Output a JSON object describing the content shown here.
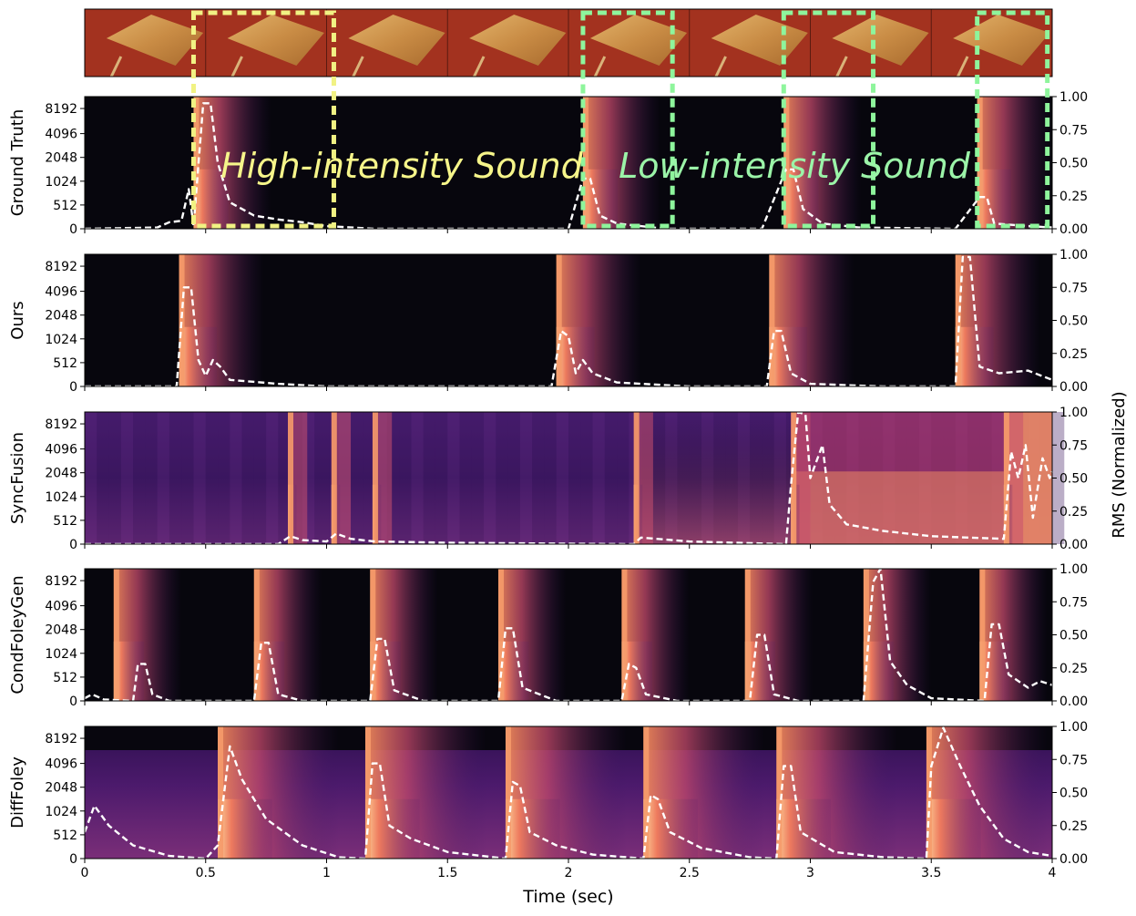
{
  "colors": {
    "high_box": "#f1f283",
    "low_box": "#8ef59c",
    "high_text": "#f6f58a",
    "low_text": "#9bf4a8",
    "rms_line": "#ffffff"
  },
  "filmstrip": {
    "frames": 8,
    "high_boxes": [
      [
        0.45,
        1.03
      ]
    ],
    "low_boxes": [
      [
        2.06,
        2.43
      ],
      [
        2.89,
        3.26
      ],
      [
        3.69,
        3.98
      ]
    ]
  },
  "annotations": {
    "high": "High-intensity Sound",
    "low": "Low-intensity Sound"
  },
  "axes": {
    "xlabel": "Time (sec)",
    "right_label": "RMS (Normalized)",
    "x_ticks": [
      "0",
      "0.5",
      "1",
      "1.5",
      "2",
      "2.5",
      "3",
      "3.5",
      "4"
    ],
    "y_ticks": [
      "0",
      "512",
      "1024",
      "2048",
      "4096",
      "8192"
    ],
    "rms_ticks": [
      "0.00",
      "0.25",
      "0.50",
      "0.75",
      "1.00"
    ]
  },
  "chart_data": [
    {
      "type": "line",
      "title": "",
      "ylabel": "Ground Truth",
      "xlim": [
        0,
        4
      ],
      "ylim": [
        0,
        1
      ],
      "onsets": [
        0.45,
        2.06,
        2.89,
        3.69
      ],
      "rms": [
        [
          0,
          0
        ],
        [
          0.3,
          0.01
        ],
        [
          0.35,
          0.05
        ],
        [
          0.4,
          0.06
        ],
        [
          0.43,
          0.3
        ],
        [
          0.45,
          0.02
        ],
        [
          0.49,
          0.95
        ],
        [
          0.52,
          0.95
        ],
        [
          0.55,
          0.5
        ],
        [
          0.6,
          0.2
        ],
        [
          0.7,
          0.1
        ],
        [
          0.8,
          0.07
        ],
        [
          0.9,
          0.05
        ],
        [
          1.0,
          0.02
        ],
        [
          1.2,
          0.0
        ],
        [
          2.0,
          0.0
        ],
        [
          2.06,
          0.38
        ],
        [
          2.09,
          0.38
        ],
        [
          2.13,
          0.1
        ],
        [
          2.2,
          0.04
        ],
        [
          2.4,
          0.0
        ],
        [
          2.8,
          0.0
        ],
        [
          2.9,
          0.45
        ],
        [
          2.93,
          0.45
        ],
        [
          2.97,
          0.15
        ],
        [
          3.05,
          0.04
        ],
        [
          3.2,
          0.01
        ],
        [
          3.6,
          0.0
        ],
        [
          3.7,
          0.24
        ],
        [
          3.73,
          0.24
        ],
        [
          3.76,
          0.04
        ],
        [
          3.9,
          0.02
        ],
        [
          4.0,
          0.01
        ]
      ]
    },
    {
      "type": "line",
      "title": "",
      "ylabel": "Ours",
      "xlim": [
        0,
        4
      ],
      "ylim": [
        0,
        1
      ],
      "onsets": [
        0.39,
        1.95,
        2.83,
        3.6
      ],
      "rms": [
        [
          0,
          0
        ],
        [
          0.38,
          0.0
        ],
        [
          0.41,
          0.75
        ],
        [
          0.44,
          0.75
        ],
        [
          0.47,
          0.2
        ],
        [
          0.5,
          0.08
        ],
        [
          0.53,
          0.2
        ],
        [
          0.56,
          0.15
        ],
        [
          0.6,
          0.05
        ],
        [
          0.8,
          0.02
        ],
        [
          1.0,
          0.0
        ],
        [
          1.93,
          0.0
        ],
        [
          1.97,
          0.42
        ],
        [
          2.0,
          0.38
        ],
        [
          2.03,
          0.1
        ],
        [
          2.06,
          0.2
        ],
        [
          2.1,
          0.1
        ],
        [
          2.2,
          0.03
        ],
        [
          2.5,
          0.0
        ],
        [
          2.82,
          0.0
        ],
        [
          2.85,
          0.42
        ],
        [
          2.88,
          0.42
        ],
        [
          2.92,
          0.1
        ],
        [
          3.0,
          0.02
        ],
        [
          3.3,
          0.0
        ],
        [
          3.6,
          0.0
        ],
        [
          3.63,
          0.98
        ],
        [
          3.66,
          0.98
        ],
        [
          3.7,
          0.15
        ],
        [
          3.78,
          0.1
        ],
        [
          3.9,
          0.12
        ],
        [
          4.0,
          0.05
        ]
      ]
    },
    {
      "type": "line",
      "title": "",
      "ylabel": "SyncFusion",
      "xlim": [
        0,
        4
      ],
      "ylim": [
        0,
        1
      ],
      "onsets": [
        0.84,
        1.02,
        1.19,
        2.27,
        2.92,
        3.8
      ],
      "rms": [
        [
          0,
          0
        ],
        [
          0.8,
          0.0
        ],
        [
          0.85,
          0.06
        ],
        [
          0.9,
          0.03
        ],
        [
          1.0,
          0.02
        ],
        [
          1.04,
          0.08
        ],
        [
          1.1,
          0.04
        ],
        [
          1.2,
          0.02
        ],
        [
          1.5,
          0.01
        ],
        [
          2.27,
          0.0
        ],
        [
          2.3,
          0.05
        ],
        [
          2.5,
          0.02
        ],
        [
          2.9,
          0.0
        ],
        [
          2.92,
          0.45
        ],
        [
          2.95,
          1.0
        ],
        [
          2.98,
          0.98
        ],
        [
          3.0,
          0.5
        ],
        [
          3.05,
          0.75
        ],
        [
          3.08,
          0.3
        ],
        [
          3.15,
          0.15
        ],
        [
          3.3,
          0.1
        ],
        [
          3.5,
          0.06
        ],
        [
          3.8,
          0.04
        ],
        [
          3.83,
          0.7
        ],
        [
          3.86,
          0.5
        ],
        [
          3.89,
          0.75
        ],
        [
          3.92,
          0.2
        ],
        [
          3.96,
          0.65
        ],
        [
          3.99,
          0.5
        ],
        [
          4.0,
          0.55
        ]
      ]
    },
    {
      "type": "line",
      "title": "",
      "ylabel": "CondFoleyGen",
      "xlim": [
        0,
        4
      ],
      "ylim": [
        0,
        1
      ],
      "onsets": [
        0.12,
        0.7,
        1.18,
        1.71,
        2.22,
        2.73,
        3.22,
        3.7
      ],
      "rms": [
        [
          0,
          0.02
        ],
        [
          0.03,
          0.05
        ],
        [
          0.08,
          0.01
        ],
        [
          0.2,
          0.0
        ],
        [
          0.22,
          0.28
        ],
        [
          0.25,
          0.28
        ],
        [
          0.28,
          0.05
        ],
        [
          0.35,
          0.0
        ],
        [
          0.7,
          0.0
        ],
        [
          0.73,
          0.44
        ],
        [
          0.76,
          0.44
        ],
        [
          0.8,
          0.05
        ],
        [
          0.9,
          0.0
        ],
        [
          1.18,
          0.0
        ],
        [
          1.21,
          0.47
        ],
        [
          1.24,
          0.47
        ],
        [
          1.28,
          0.08
        ],
        [
          1.4,
          0.0
        ],
        [
          1.71,
          0.0
        ],
        [
          1.74,
          0.55
        ],
        [
          1.77,
          0.55
        ],
        [
          1.81,
          0.1
        ],
        [
          1.95,
          0.0
        ],
        [
          2.22,
          0.0
        ],
        [
          2.25,
          0.28
        ],
        [
          2.28,
          0.25
        ],
        [
          2.32,
          0.05
        ],
        [
          2.45,
          0.0
        ],
        [
          2.75,
          0.0
        ],
        [
          2.78,
          0.5
        ],
        [
          2.81,
          0.5
        ],
        [
          2.85,
          0.05
        ],
        [
          2.95,
          0.0
        ],
        [
          3.22,
          0.0
        ],
        [
          3.26,
          0.9
        ],
        [
          3.29,
          1.0
        ],
        [
          3.33,
          0.3
        ],
        [
          3.4,
          0.12
        ],
        [
          3.5,
          0.02
        ],
        [
          3.72,
          0.0
        ],
        [
          3.75,
          0.58
        ],
        [
          3.78,
          0.58
        ],
        [
          3.82,
          0.2
        ],
        [
          3.9,
          0.1
        ],
        [
          3.95,
          0.15
        ],
        [
          4.0,
          0.12
        ]
      ]
    },
    {
      "type": "line",
      "title": "",
      "ylabel": "DiffFoley",
      "xlim": [
        0,
        4
      ],
      "ylim": [
        0,
        1
      ],
      "onsets": [
        0.55,
        1.16,
        1.74,
        2.31,
        2.86,
        3.48
      ],
      "rms": [
        [
          0,
          0.2
        ],
        [
          0.04,
          0.4
        ],
        [
          0.1,
          0.25
        ],
        [
          0.2,
          0.1
        ],
        [
          0.35,
          0.02
        ],
        [
          0.5,
          0.0
        ],
        [
          0.55,
          0.1
        ],
        [
          0.6,
          0.85
        ],
        [
          0.65,
          0.6
        ],
        [
          0.75,
          0.3
        ],
        [
          0.9,
          0.1
        ],
        [
          1.05,
          0.01
        ],
        [
          1.16,
          0.0
        ],
        [
          1.19,
          0.72
        ],
        [
          1.22,
          0.72
        ],
        [
          1.26,
          0.25
        ],
        [
          1.35,
          0.15
        ],
        [
          1.5,
          0.05
        ],
        [
          1.74,
          0.0
        ],
        [
          1.77,
          0.58
        ],
        [
          1.8,
          0.55
        ],
        [
          1.84,
          0.2
        ],
        [
          1.95,
          0.1
        ],
        [
          2.1,
          0.03
        ],
        [
          2.31,
          0.0
        ],
        [
          2.34,
          0.48
        ],
        [
          2.37,
          0.45
        ],
        [
          2.42,
          0.2
        ],
        [
          2.55,
          0.08
        ],
        [
          2.75,
          0.01
        ],
        [
          2.86,
          0.0
        ],
        [
          2.89,
          0.7
        ],
        [
          2.92,
          0.7
        ],
        [
          2.96,
          0.2
        ],
        [
          3.1,
          0.05
        ],
        [
          3.3,
          0.01
        ],
        [
          3.48,
          0.0
        ],
        [
          3.5,
          0.7
        ],
        [
          3.55,
          0.99
        ],
        [
          3.62,
          0.7
        ],
        [
          3.7,
          0.4
        ],
        [
          3.8,
          0.15
        ],
        [
          3.9,
          0.05
        ],
        [
          4.0,
          0.02
        ]
      ]
    }
  ]
}
